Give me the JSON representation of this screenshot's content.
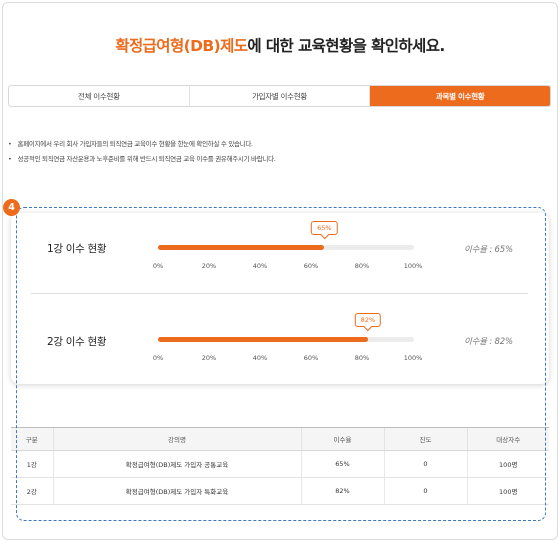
{
  "header": {
    "title_highlight": "확정급여형(DB)제도",
    "title_rest": "에 대한 교육현황을 확인하세요."
  },
  "tabs": [
    {
      "label": "전체 이수현황",
      "active": false
    },
    {
      "label": "가입자별 이수현황",
      "active": false
    },
    {
      "label": "과목별 이수현황",
      "active": true
    }
  ],
  "notes": [
    "홈페이지에서 우리 회사 가입자들의 퇴직연금 교육이수 현황을 한눈에 확인하실 수 있습니다.",
    "성공적인 퇴직연금 자산운용과 노후준비를 위해 반드시 퇴직연금 교육 이수를 권유해주시기 바랍니다."
  ],
  "step_badge": "4",
  "progress": {
    "ticks": [
      "0%",
      "20%",
      "40%",
      "60%",
      "80%",
      "100%"
    ],
    "items": [
      {
        "title": "1강 이수 현황",
        "percent": 65,
        "bubble": "65%",
        "rate_text": "이수율 : 65%"
      },
      {
        "title": "2강 이수 현황",
        "percent": 82,
        "bubble": "82%",
        "rate_text": "이수율 : 82%"
      }
    ]
  },
  "table": {
    "headers": [
      "구분",
      "강의명",
      "이수율",
      "진도",
      "대상자수"
    ],
    "rows": [
      [
        "1강",
        "확정급여형(DB)제도 가입자 공통교육",
        "65%",
        "0",
        "100명"
      ],
      [
        "2강",
        "확정급여형(DB)제도 가입자 특화교육",
        "82%",
        "0",
        "100명"
      ]
    ]
  },
  "colors": {
    "accent": "#ec6b1c",
    "dashed_border": "#3e78c2"
  }
}
